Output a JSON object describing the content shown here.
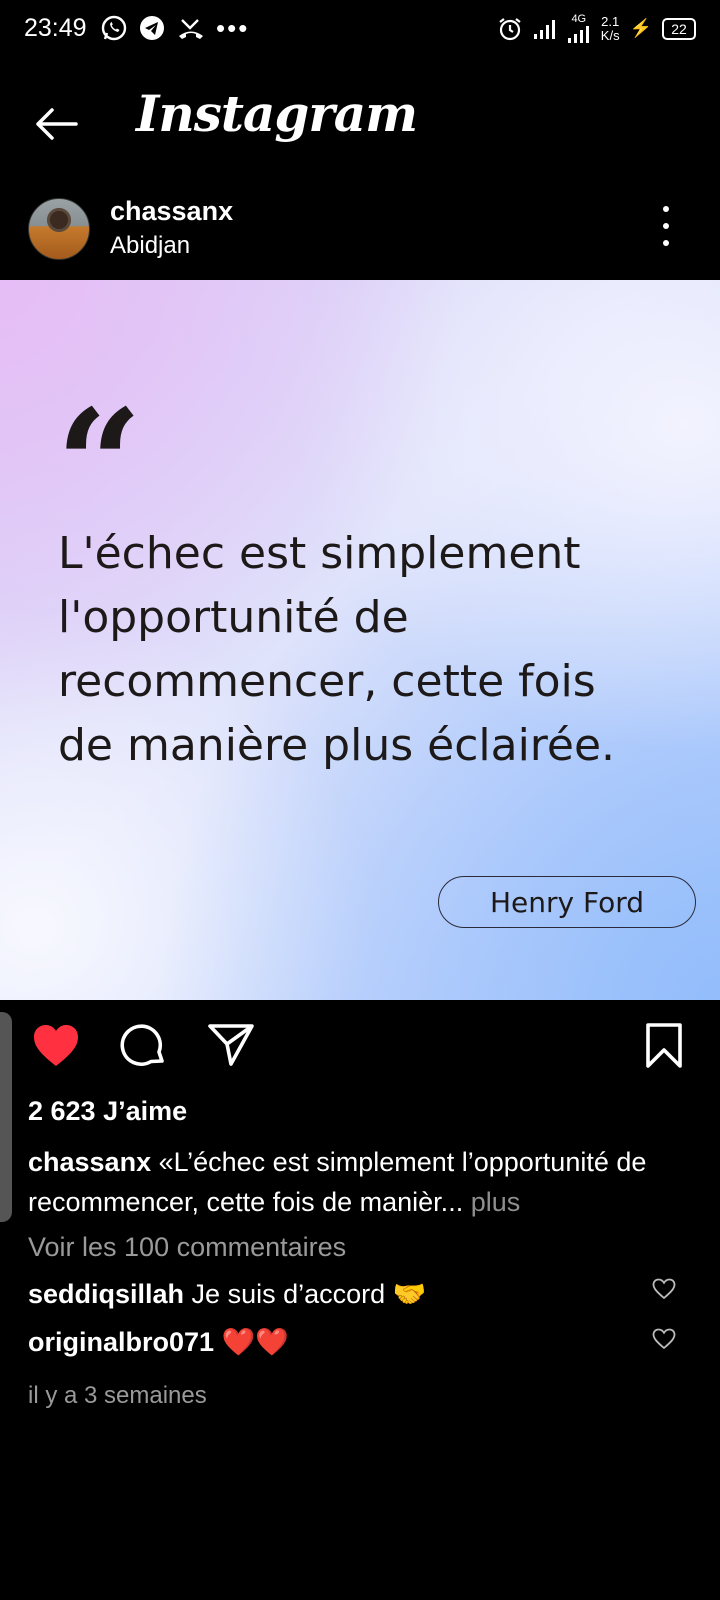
{
  "status_bar": {
    "time": "23:49",
    "left_icons": [
      "whatsapp-icon",
      "telegram-icon",
      "missed-call-icon",
      "more-notifications-icon"
    ],
    "network": "4G",
    "speed_value": "2.1",
    "speed_unit": "K/s",
    "battery": "22"
  },
  "top_bar": {
    "title": "Instagram"
  },
  "post": {
    "username": "chassanx",
    "location": "Abidjan",
    "image": {
      "quote_mark": "“",
      "quote": "L'échec est simplement l'opportunité de recommencer, cette fois de manière plus éclairée.",
      "author": "Henry Ford",
      "colors": {
        "pink": "#e6bdf6",
        "blue": "#93bdfb",
        "text": "#1d1919"
      }
    },
    "liked": true,
    "like_color": "#ff3040",
    "likes": "2 623 J’aime",
    "caption_user": "chassanx",
    "caption_text": " «L’échec est simplement l’opportunité de recommencer, cette fois de manièr...",
    "caption_more": " plus",
    "view_comments": "Voir les 100 commentaires",
    "comments": [
      {
        "user": "seddiqsillah",
        "text": " Je suis d’accord 🤝"
      },
      {
        "user": "originalbro071",
        "text": " ❤️❤️"
      }
    ],
    "timestamp": "il y a 3 semaines"
  }
}
